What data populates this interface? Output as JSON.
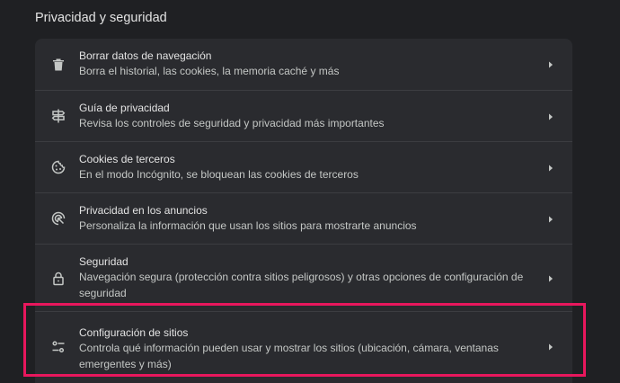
{
  "section": {
    "title": "Privacidad y seguridad"
  },
  "items": [
    {
      "icon": "trash-icon",
      "label": "Borrar datos de navegación",
      "sub": "Borra el historial, las cookies, la memoria caché y más"
    },
    {
      "icon": "signpost-icon",
      "label": "Guía de privacidad",
      "sub": "Revisa los controles de seguridad y privacidad más importantes"
    },
    {
      "icon": "cookie-icon",
      "label": "Cookies de terceros",
      "sub": "En el modo Incógnito, se bloquean las cookies de terceros"
    },
    {
      "icon": "ads-privacy-icon",
      "label": "Privacidad en los anuncios",
      "sub": "Personaliza la información que usan los sitios para mostrarte anuncios"
    },
    {
      "icon": "lock-icon",
      "label": "Seguridad",
      "sub": "Navegación segura (protección contra sitios peligrosos) y otras opciones de configuración de seguridad"
    },
    {
      "icon": "tune-icon",
      "label": "Configuración de sitios",
      "sub": "Controla qué información pueden usar y mostrar los sitios (ubicación, cámara, ventanas emergentes y más)"
    }
  ],
  "annotation": {
    "highlight_color": "#e8175d",
    "highlighted_item": "Configuración de sitios"
  },
  "colors": {
    "background": "#1f2023",
    "card": "#2a2b2f",
    "text": "#e3e3e3",
    "subtext": "#c4c7c5"
  }
}
